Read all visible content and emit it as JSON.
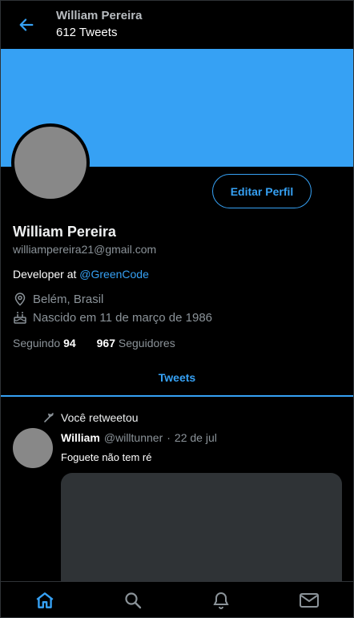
{
  "header": {
    "name": "William Pereira",
    "tweet_count": "612 Tweets"
  },
  "profile": {
    "edit_label": "Editar Perfil",
    "name": "William Pereira",
    "email": "williampereira21@gmail.com",
    "bio_prefix": "Developer at ",
    "bio_mention": "@GreenCode",
    "location": "Belém, Brasil",
    "birth": "Nascido em 11 de março de 1986",
    "following_label": "Seguindo",
    "following_count": "94",
    "followers_count": "967",
    "followers_label": "Seguidores"
  },
  "tabs": {
    "tweets_label": "Tweets"
  },
  "tweet": {
    "retweet_label": "Você retweetou",
    "author_name": "William",
    "author_handle": "@willtunner",
    "separator": "·",
    "date": "22 de jul",
    "text": "Foguete não tem ré"
  },
  "nav": {
    "items": [
      "home",
      "search",
      "notifications",
      "messages"
    ]
  },
  "colors": {
    "accent": "#36a1f4",
    "background": "#000000",
    "muted": "#8b9399",
    "avatar_placeholder": "#888888"
  }
}
